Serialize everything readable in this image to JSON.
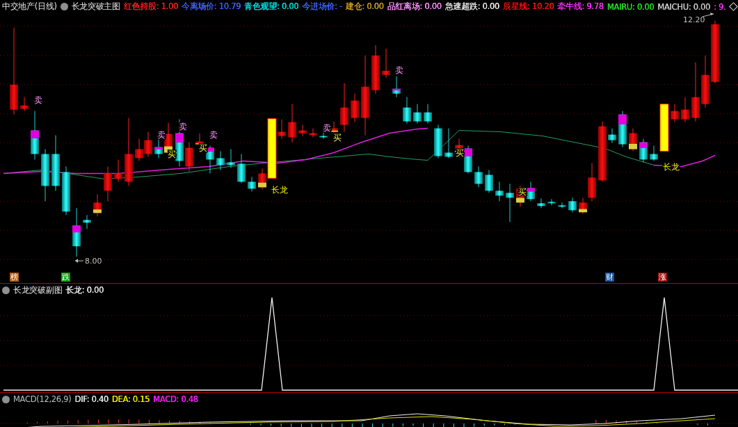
{
  "main_chart": {
    "stock": "中交地产(日线)",
    "indicator": "长龙突破主图",
    "readouts": [
      {
        "label": "红色持股:",
        "value": "1.00",
        "color": "#ff2020"
      },
      {
        "label": "今离场价:",
        "value": "10.79",
        "color": "#4060ff"
      },
      {
        "label": "青色观望:",
        "value": "0.00",
        "color": "#00e0e0"
      },
      {
        "label": "今进场价:",
        "value": "-",
        "color": "#4060ff"
      },
      {
        "label": "建仓:",
        "value": "0.00",
        "color": "#d0a020"
      },
      {
        "label": "品红离场:",
        "value": "0.00",
        "color": "#ff90ff"
      },
      {
        "label": "急速超跌:",
        "value": "0.00",
        "color": "#e8e8e8"
      },
      {
        "label": "辰星线:",
        "value": "10.20",
        "color": "#ff1010"
      },
      {
        "label": "牵牛线:",
        "value": "9.78",
        "color": "#ff30ff"
      },
      {
        "label": "MAIRU:",
        "value": "0.00",
        "color": "#20e020"
      },
      {
        "label": "MAICHU:",
        "value": "0.00",
        "color": "#c8c8c8"
      }
    ],
    "overflow_readout": ": 9.",
    "high_label": "12.20",
    "low_label": "8.00",
    "signals": [
      {
        "kind": "sell",
        "text": "卖"
      },
      {
        "kind": "sell",
        "text": "卖"
      },
      {
        "kind": "sell",
        "text": "卖"
      },
      {
        "kind": "sell",
        "text": "卖"
      },
      {
        "kind": "buy",
        "text": "买"
      },
      {
        "kind": "buy",
        "text": "买"
      },
      {
        "kind": "sell",
        "text": "卖"
      },
      {
        "kind": "buy",
        "text": "买"
      },
      {
        "kind": "sell",
        "text": "卖"
      },
      {
        "kind": "buy",
        "text": "买"
      },
      {
        "kind": "buy",
        "text": "买"
      },
      {
        "kind": "dragon",
        "text": "长龙"
      },
      {
        "kind": "dragon",
        "text": "长龙"
      }
    ]
  },
  "event_tags": [
    {
      "text": "榜",
      "color": "#b05a10"
    },
    {
      "text": "跌",
      "color": "#10a010"
    },
    {
      "text": "财",
      "color": "#1050a0"
    },
    {
      "text": "涨",
      "color": "#a01010"
    }
  ],
  "sub_chart": {
    "title": "长龙突破副图",
    "readouts": [
      {
        "label": "长龙:",
        "value": "0.00",
        "color": "#e8e8e8"
      }
    ]
  },
  "macd": {
    "title": "MACD(12,26,9)",
    "readouts": [
      {
        "label": "DIF:",
        "value": "0.40",
        "color": "#e8e8e8"
      },
      {
        "label": "DEA:",
        "value": "0.15",
        "color": "#f0f000"
      },
      {
        "label": "MACD:",
        "value": "0.48",
        "color": "#ff20ff"
      }
    ]
  }
}
